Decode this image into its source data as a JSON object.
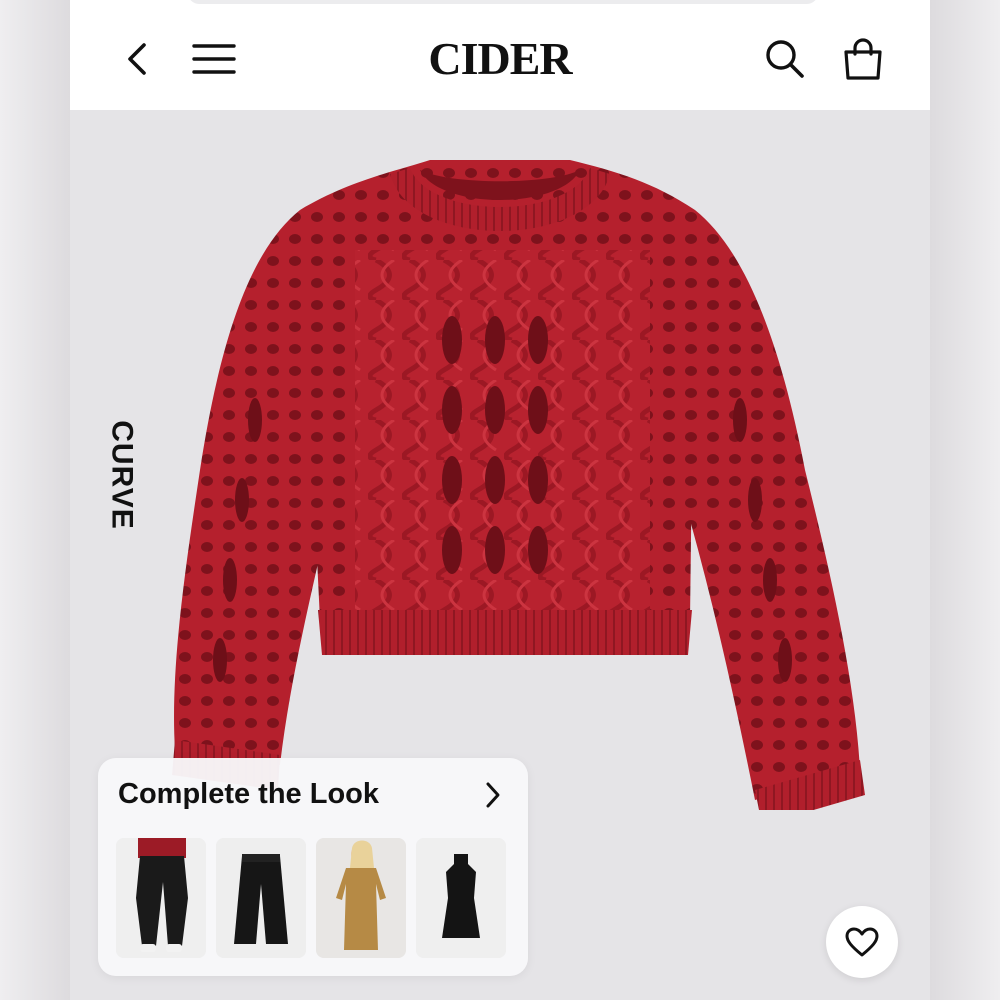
{
  "header": {
    "logo": "CIDER",
    "icons": [
      "back-arrow-icon",
      "menu-icon",
      "search-icon",
      "shopping-bag-icon"
    ]
  },
  "product": {
    "badge": "CURVE",
    "image": "red-cable-knit-sweater",
    "color": "#b5202d"
  },
  "complete_look": {
    "title": "Complete the Look",
    "items": [
      "black-balloon-pants",
      "black-wide-leg-trousers",
      "camel-sweater-dress",
      "black-sleeveless-dress"
    ]
  },
  "actions": {
    "favorite_icon": "heart-icon"
  }
}
